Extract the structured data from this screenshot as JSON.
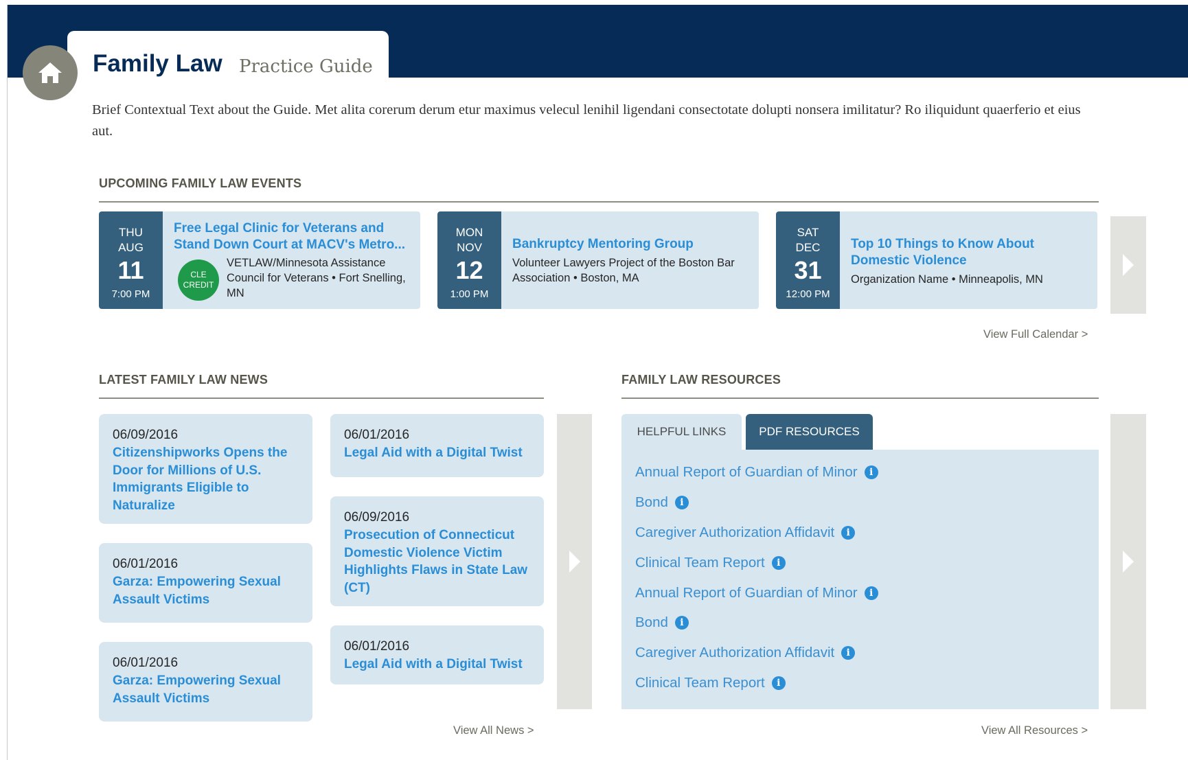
{
  "header": {
    "title": "Family Law",
    "subtitle": "Practice Guide",
    "home_icon": "home-icon",
    "band_color": "#062b57"
  },
  "intro": "Brief Contextual Text about the Guide. Met alita corerum derum etur maximus velecul lenihil ligendani consectotate dolupti nonsera imilitatur? Ro iliquidunt quaerferio et eius aut.",
  "events_section": {
    "heading": "UPCOMING FAMILY LAW EVENTS",
    "view_link": "View Full Calendar >",
    "items": [
      {
        "dow": "THU",
        "month": "AUG",
        "day": "11",
        "time": "7:00 PM",
        "title": "Free Legal Clinic for Veterans and Stand Down Court at MACV's Metro...",
        "badge_line1": "CLE",
        "badge_line2": "CREDIT",
        "detail": "VETLAW/Minnesota Assistance Council for Veterans • Fort Snelling, MN"
      },
      {
        "dow": "MON",
        "month": "NOV",
        "day": "12",
        "time": "1:00 PM",
        "title": "Bankruptcy Mentoring Group",
        "detail": "Volunteer Lawyers Project of the Boston Bar Association • Boston, MA"
      },
      {
        "dow": "SAT",
        "month": "DEC",
        "day": "31",
        "time": "12:00 PM",
        "title": "Top 10 Things to Know About Domestic Violence",
        "detail": "Organization Name • Minneapolis, MN"
      }
    ]
  },
  "news_section": {
    "heading": "LATEST FAMILY LAW NEWS",
    "view_link": "View All News >",
    "items": [
      {
        "date": "06/09/2016",
        "title": "Citizenshipworks Opens the Door for Millions of U.S. Immigrants Eligible to Naturalize"
      },
      {
        "date": "06/01/2016",
        "title": "Garza: Empowering Sexual Assault Victims"
      },
      {
        "date": "06/01/2016",
        "title": "Garza: Empowering Sexual Assault Victims"
      },
      {
        "date": "06/01/2016",
        "title": "Legal Aid with a Digital Twist"
      },
      {
        "date": "06/09/2016",
        "title": "Prosecution of Connecticut Domestic Violence Victim Highlights Flaws in State Law (CT)"
      },
      {
        "date": "06/01/2016",
        "title": "Legal Aid with a Digital Twist"
      }
    ]
  },
  "resources_section": {
    "heading": "FAMILY LAW RESOURCES",
    "view_link": "View All Resources >",
    "tabs": [
      {
        "label": "HELPFUL LINKS",
        "active": false
      },
      {
        "label": "PDF RESOURCES",
        "active": true
      }
    ],
    "info_glyph": "i",
    "items": [
      "Annual Report of Guardian of Minor",
      "Bond",
      "Caregiver Authorization Affidavit",
      "Clinical Team Report",
      "Annual Report of Guardian of Minor",
      "Bond",
      "Caregiver Authorization Affidavit",
      "Clinical Team Report"
    ]
  },
  "colors": {
    "navy": "#062b57",
    "date_block": "#34607d",
    "card_bg": "#d8e6f0",
    "link_blue": "#2a8ed6",
    "cle_green": "#1f9a4a"
  }
}
